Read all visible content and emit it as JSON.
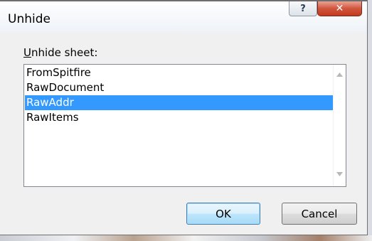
{
  "dialog": {
    "title": "Unhide",
    "help_label": "?",
    "close_label": "✕",
    "prompt": {
      "accel": "U",
      "rest": "nhide sheet:"
    },
    "sheets": [
      {
        "label": "FromSpitfire",
        "selected": false
      },
      {
        "label": "RawDocument",
        "selected": false
      },
      {
        "label": "RawAddr",
        "selected": true
      },
      {
        "label": "RawItems",
        "selected": false
      }
    ],
    "ok_label": "OK",
    "cancel_label": "Cancel"
  }
}
